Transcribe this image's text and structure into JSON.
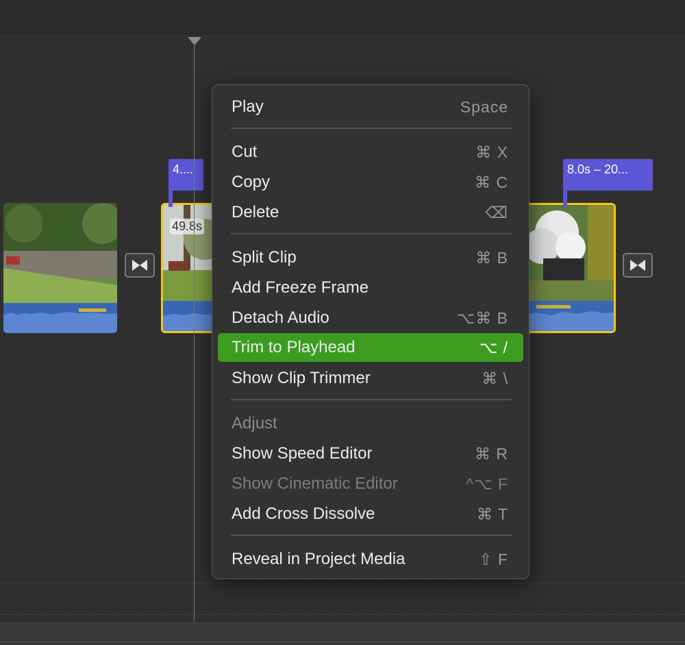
{
  "timeline": {
    "clips": [
      {
        "id": "clip1",
        "selected": false
      },
      {
        "id": "clip2",
        "selected": true,
        "duration_label": "49.8s",
        "tag": "4...."
      },
      {
        "id": "clip3",
        "selected": true,
        "tag": "8.0s – 20..."
      }
    ],
    "transition_icon": "bowtie-transition-icon",
    "colors": {
      "selection": "#f5c518",
      "tag": "#5b56d6",
      "audio": "#3e6ec1"
    }
  },
  "context_menu": {
    "items": [
      {
        "label": "Play",
        "shortcut": "Space"
      },
      {
        "label": "Cut",
        "shortcut": "⌘ X"
      },
      {
        "label": "Copy",
        "shortcut": "⌘ C"
      },
      {
        "label": "Delete",
        "shortcut": "⌫"
      },
      {
        "label": "Split Clip",
        "shortcut": "⌘ B"
      },
      {
        "label": "Add Freeze Frame",
        "shortcut": ""
      },
      {
        "label": "Detach Audio",
        "shortcut": "⌥⌘ B"
      },
      {
        "label": "Trim to Playhead",
        "shortcut": "⌥  /",
        "highlighted": true
      },
      {
        "label": "Show Clip Trimmer",
        "shortcut": "⌘  \\"
      },
      {
        "label": "Adjust",
        "shortcut": "",
        "header": true
      },
      {
        "label": "Show Speed Editor",
        "shortcut": "⌘ R"
      },
      {
        "label": "Show Cinematic Editor",
        "shortcut": "^⌥ F",
        "disabled": true
      },
      {
        "label": "Add Cross Dissolve",
        "shortcut": "⌘ T"
      },
      {
        "label": "Reveal in Project Media",
        "shortcut": "⇧ F"
      }
    ],
    "highlight_color": "#3b9c1f"
  }
}
